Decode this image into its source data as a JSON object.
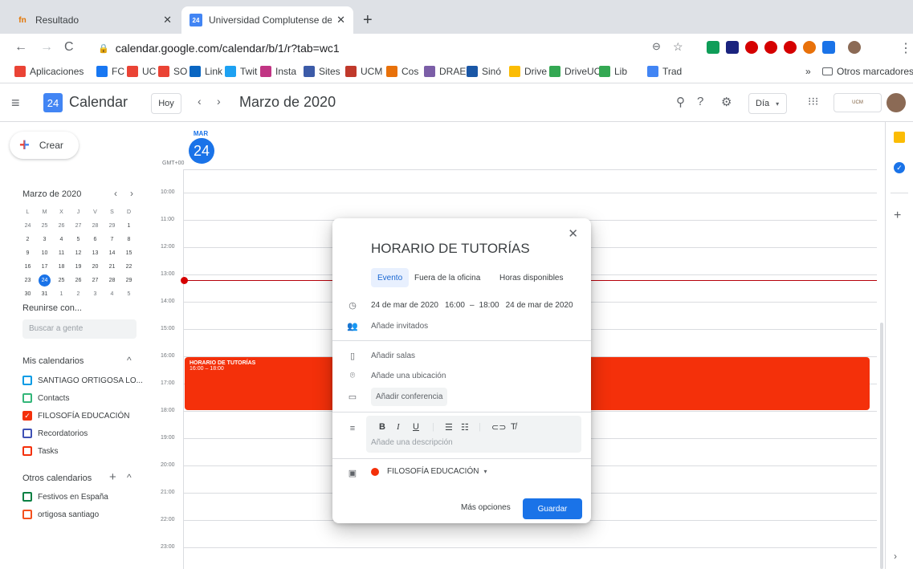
{
  "browser": {
    "tabs": [
      {
        "title": "Resultado",
        "favicon": "fn",
        "favicon_color": "#e37400"
      },
      {
        "title": "Universidad Complutense de Ma",
        "favicon": "24",
        "favicon_color": "#4285f4"
      }
    ],
    "url": "calendar.google.com/calendar/b/1/r?tab=wc1",
    "bookmarks": [
      {
        "label": "Aplicaciones",
        "icon": "apps-grid-icon",
        "color": "#ea4335"
      },
      {
        "label": "FC",
        "icon": "facebook-icon",
        "color": "#1877f2"
      },
      {
        "label": "UC",
        "icon": "gmail-icon",
        "color": "#ea4335"
      },
      {
        "label": "SO",
        "icon": "gmail-icon",
        "color": "#ea4335"
      },
      {
        "label": "Link",
        "icon": "linkedin-icon",
        "color": "#0a66c2"
      },
      {
        "label": "Twit",
        "icon": "twitter-icon",
        "color": "#1da1f2"
      },
      {
        "label": "Insta",
        "icon": "instagram-icon",
        "color": "#c13584"
      },
      {
        "label": "Sites",
        "icon": "sites-icon",
        "color": "#3c5ba8"
      },
      {
        "label": "UCM",
        "icon": "ucm-icon",
        "color": "#c0392b"
      },
      {
        "label": "Cos",
        "icon": "cos-icon",
        "color": "#e8710a"
      },
      {
        "label": "DRAE",
        "icon": "drae-icon",
        "color": "#7b5ea7"
      },
      {
        "label": "Sinó",
        "icon": "wordreference-icon",
        "color": "#1a57a6"
      },
      {
        "label": "Drive",
        "icon": "drive-icon",
        "color": "#fbbc04"
      },
      {
        "label": "DriveUCM",
        "icon": "drive-icon",
        "color": "#34a853"
      },
      {
        "label": "Lib",
        "icon": "play-icon",
        "color": "#34a853"
      },
      {
        "label": "Trad",
        "icon": "translate-icon",
        "color": "#4285f4"
      }
    ],
    "more": "»",
    "other_bookmarks": "Otros marcadores"
  },
  "calendar": {
    "app_title": "Calendar",
    "logo_day": "24",
    "today_button": "Hoy",
    "month_title": "Marzo de 2020",
    "view_selector": "Día",
    "brand_color": "#1a73e8",
    "event_color": "#f4300a"
  },
  "sidebar": {
    "create": "Crear",
    "mini_month": "Marzo de 2020",
    "weekdays": [
      "L",
      "M",
      "X",
      "J",
      "V",
      "S",
      "D"
    ],
    "weeks": [
      [
        "24",
        "25",
        "26",
        "27",
        "28",
        "29",
        "1"
      ],
      [
        "2",
        "3",
        "4",
        "5",
        "6",
        "7",
        "8"
      ],
      [
        "9",
        "10",
        "11",
        "12",
        "13",
        "14",
        "15"
      ],
      [
        "16",
        "17",
        "18",
        "19",
        "20",
        "21",
        "22"
      ],
      [
        "23",
        "24",
        "25",
        "26",
        "27",
        "28",
        "29"
      ],
      [
        "30",
        "31",
        "1",
        "2",
        "3",
        "4",
        "5"
      ]
    ],
    "meet_with": "Reunirse con...",
    "search_people": "Buscar a gente",
    "my_calendars": "Mis calendarios",
    "my_calendar_items": [
      {
        "label": "SANTIAGO ORTIGOSA LO...",
        "color": "#039be5",
        "checked": false
      },
      {
        "label": "Contacts",
        "color": "#33b679",
        "checked": false
      },
      {
        "label": "FILOSOFÍA EDUCACIÓN",
        "color": "#f4300a",
        "checked": true
      },
      {
        "label": "Recordatorios",
        "color": "#3f51b5",
        "checked": false
      },
      {
        "label": "Tasks",
        "color": "#f4300a",
        "checked": false
      }
    ],
    "other_calendars": "Otros calendarios",
    "other_calendar_items": [
      {
        "label": "Festivos en España",
        "color": "#0b8043",
        "checked": false
      },
      {
        "label": "ortigosa santiago",
        "color": "#f4511e",
        "checked": false
      }
    ]
  },
  "day_view": {
    "weekday": "MAR",
    "day": "24",
    "timezone": "GMT+00",
    "hours": [
      "10:00",
      "11:00",
      "12:00",
      "13:00",
      "14:00",
      "15:00",
      "16:00",
      "17:00",
      "18:00",
      "19:00",
      "20:00",
      "21:00",
      "22:00",
      "23:00"
    ],
    "event": {
      "title": "HORARIO DE TUTORÍAS",
      "time": "16:00 – 18:00"
    }
  },
  "dialog": {
    "title": "HORARIO DE TUTORÍAS",
    "tabs": [
      "Evento",
      "Fuera de la oficina",
      "Horas disponibles"
    ],
    "start_date": "24 de mar de 2020",
    "start_time": "16:00",
    "dash": "–",
    "end_time": "18:00",
    "end_date": "24 de mar de 2020",
    "add_guests": "Añade invitados",
    "add_rooms": "Añadir salas",
    "add_location": "Añade una ubicación",
    "add_conference": "Añadir conferencia",
    "add_description": "Añade una descripción",
    "calendar_name": "FILOSOFÍA EDUCACIÓN",
    "more_options": "Más opciones",
    "save": "Guardar"
  }
}
